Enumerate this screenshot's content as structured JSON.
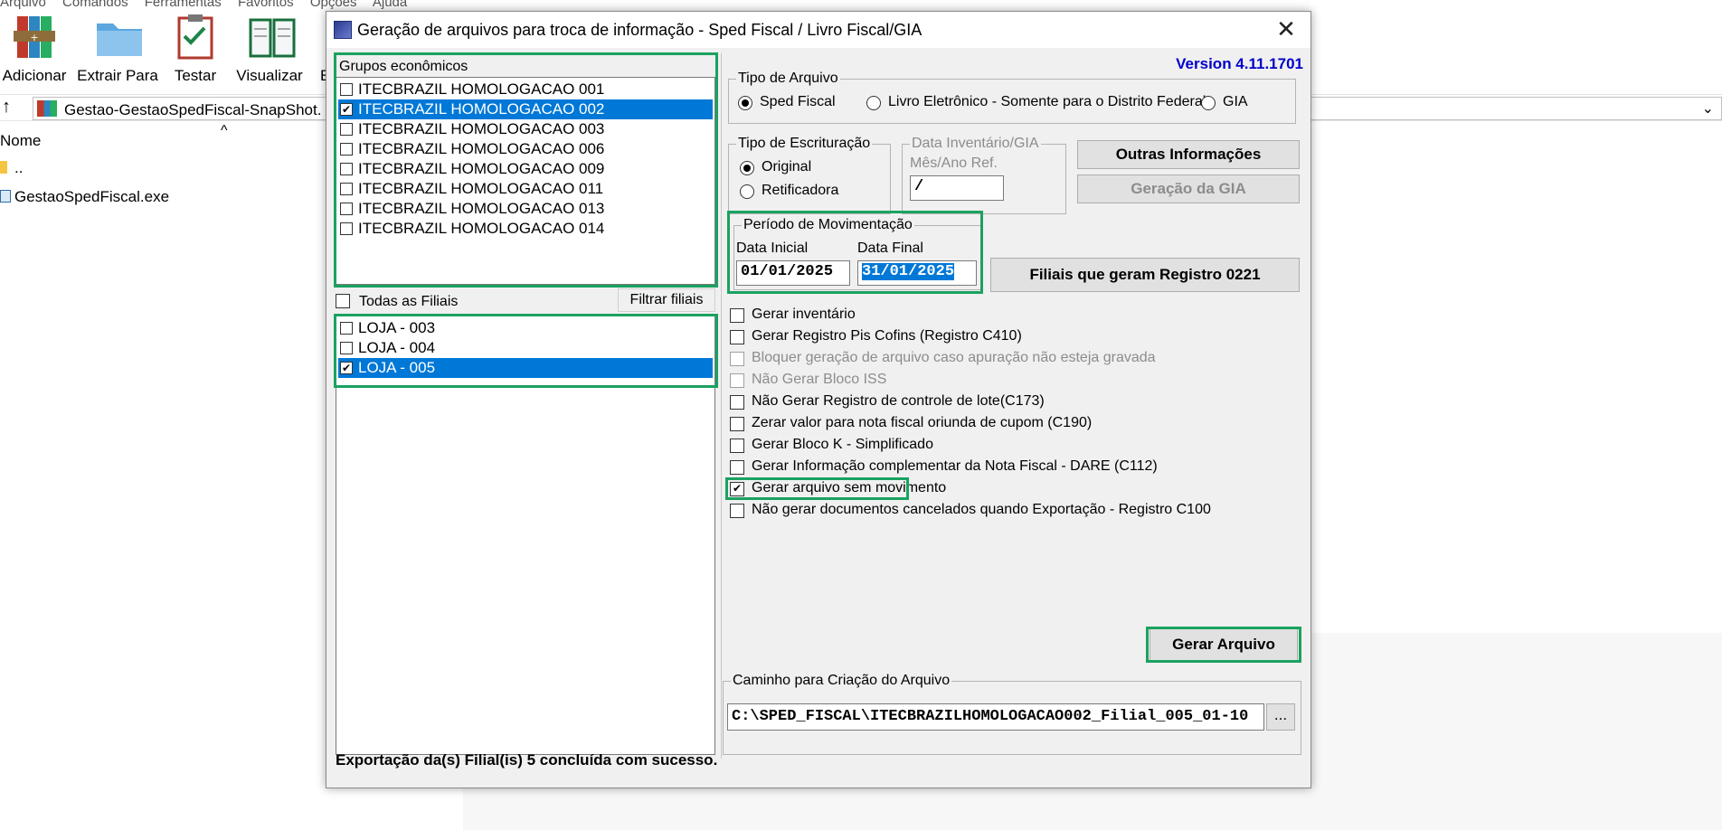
{
  "background": {
    "menu": [
      "Arquivo",
      "Comandos",
      "Ferramentas",
      "Favoritos",
      "Opções",
      "Ajuda"
    ],
    "toolbar": [
      "Adicionar",
      "Extrair Para",
      "Testar",
      "Visualizar",
      "E"
    ],
    "address": "Gestao-GestaoSpedFiscal-SnapShot.",
    "column_name": "Nome",
    "files": [
      {
        "name": ".."
      },
      {
        "name": "GestaoSpedFiscal.exe"
      }
    ]
  },
  "dialog": {
    "title": "Geração de arquivos para troca de informação - Sped Fiscal / Livro Fiscal/GIA",
    "close": "✕",
    "version": "Version 4.11.1701",
    "groups": {
      "label": "Grupos econômicos",
      "items": [
        {
          "label": "ITECBRAZIL HOMOLOGACAO 001",
          "checked": false,
          "selected": false
        },
        {
          "label": "ITECBRAZIL HOMOLOGACAO 002",
          "checked": true,
          "selected": true
        },
        {
          "label": "ITECBRAZIL HOMOLOGACAO 003",
          "checked": false,
          "selected": false
        },
        {
          "label": "ITECBRAZIL HOMOLOGACAO 006",
          "checked": false,
          "selected": false
        },
        {
          "label": "ITECBRAZIL HOMOLOGACAO 009",
          "checked": false,
          "selected": false
        },
        {
          "label": "ITECBRAZIL HOMOLOGACAO 011",
          "checked": false,
          "selected": false
        },
        {
          "label": "ITECBRAZIL HOMOLOGACAO 013",
          "checked": false,
          "selected": false
        },
        {
          "label": "ITECBRAZIL HOMOLOGACAO 014",
          "checked": false,
          "selected": false
        }
      ]
    },
    "branches": {
      "all_label": "Todas as Filiais",
      "filter_button": "Filtrar filiais",
      "items": [
        {
          "label": "LOJA - 003",
          "checked": false,
          "selected": false
        },
        {
          "label": "LOJA - 004",
          "checked": false,
          "selected": false
        },
        {
          "label": "LOJA - 005",
          "checked": true,
          "selected": true
        }
      ]
    },
    "file_type": {
      "label": "Tipo de Arquivo",
      "options": [
        "Sped Fiscal",
        "Livro Eletrônico - Somente para o Distrito Federal",
        "GIA"
      ],
      "selected": "Sped Fiscal"
    },
    "bookkeeping": {
      "label": "Tipo de Escrituração",
      "options": [
        "Original",
        "Retificadora"
      ],
      "selected": "Original"
    },
    "inventory": {
      "label": "Data Inventário/GIA",
      "sub_label": "Mês/Ano Ref.",
      "value": " /"
    },
    "other_info_button": "Outras Informações",
    "gia_button": "Geração da GIA",
    "period": {
      "label": "Período de Movimentação",
      "start_label": "Data Inicial",
      "start_value": "01/01/2025",
      "end_label": "Data Final",
      "end_value": "31/01/2025"
    },
    "branches_0221_button": "Filiais que geram Registro 0221",
    "options": [
      {
        "label": "Gerar inventário",
        "checked": false,
        "disabled": false
      },
      {
        "label": "Gerar Registro Pis Cofins (Registro C410)",
        "checked": false,
        "disabled": false
      },
      {
        "label": "Bloquer geração de arquivo caso apuração não esteja gravada",
        "checked": false,
        "disabled": true
      },
      {
        "label": "Não Gerar Bloco ISS",
        "checked": false,
        "disabled": true
      },
      {
        "label": "Não Gerar Registro de controle de lote(C173)",
        "checked": false,
        "disabled": false
      },
      {
        "label": "Zerar valor para nota fiscal oriunda de cupom (C190)",
        "checked": false,
        "disabled": false
      },
      {
        "label": "Gerar Bloco K  -  Simplificado",
        "checked": false,
        "disabled": false
      },
      {
        "label": "Gerar Informação complementar da Nota Fiscal - DARE (C112)",
        "checked": false,
        "disabled": false
      },
      {
        "label": "Gerar arquivo sem movimento",
        "checked": true,
        "disabled": false
      },
      {
        "label": "Não gerar documentos cancelados quando Exportação - Registro C100",
        "checked": false,
        "disabled": false
      }
    ],
    "generate_button": "Gerar Arquivo",
    "path": {
      "label": "Caminho para Criação do Arquivo",
      "value": "C:\\SPED_FISCAL\\ITECBRAZILHOMOLOGACAO002_Filial_005_01-10",
      "browse": "..."
    },
    "status": "Exportação da(s) Filial(is) 5 concluída com sucesso.",
    "colors": {
      "selection": "#0078d7",
      "highlight_box": "#1aa260",
      "version_text": "#0000cc"
    }
  }
}
